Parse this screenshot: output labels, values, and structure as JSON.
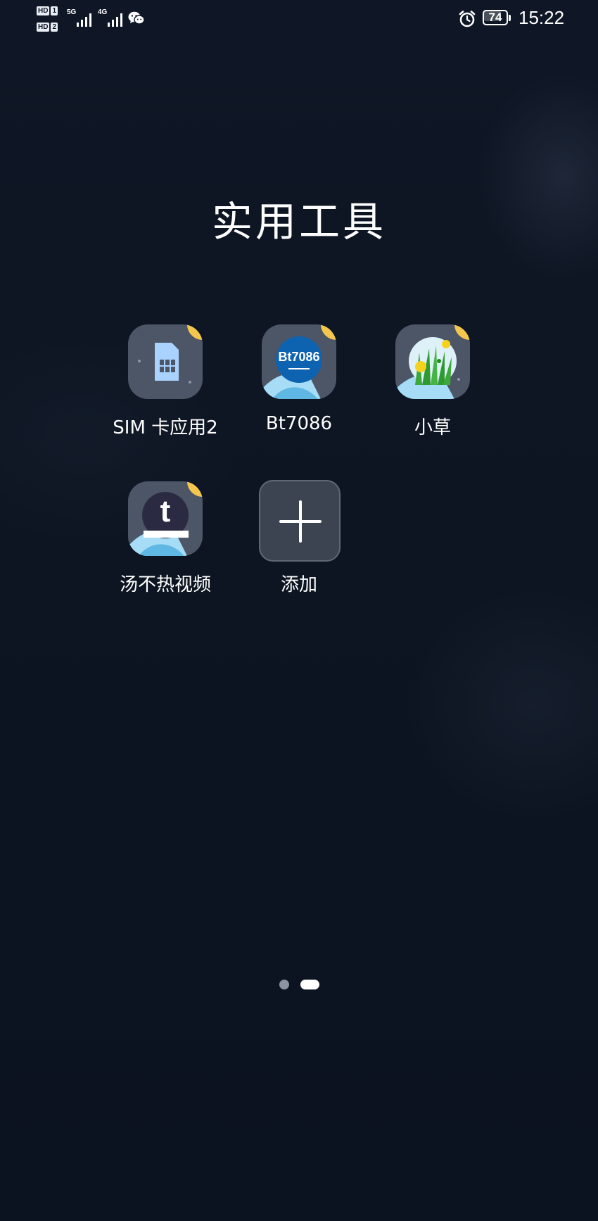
{
  "status_bar": {
    "sim1": {
      "hd": "HD",
      "slot": "1"
    },
    "sim2": {
      "hd": "HD",
      "slot": "2"
    },
    "signal1_tech": "5G",
    "signal2_tech": "4G",
    "notification_icon": "wechat-icon",
    "alarm_icon": "alarm-clock-icon",
    "battery_percent": "74",
    "battery_level": 0.74,
    "time": "15:22"
  },
  "folder": {
    "title": "实用工具"
  },
  "apps": [
    {
      "label": "SIM 卡应用2",
      "icon": "sim-card-icon",
      "badge_text": ""
    },
    {
      "label": "Bt7086",
      "icon": "bt7086-logo-icon",
      "badge_text": "Bt7086"
    },
    {
      "label": "小草",
      "icon": "grass-icon",
      "badge_text": ""
    },
    {
      "label": "汤不热视频",
      "icon": "tumblr-t-icon",
      "badge_text": "t"
    }
  ],
  "add_button": {
    "label": "添加",
    "icon": "plus-icon"
  },
  "pager": {
    "pages": 2,
    "current": 2
  },
  "colors": {
    "background": "#0d1522",
    "text": "#ffffff",
    "accent_corner": "#f4c64d",
    "icon_plate": "#4f5868"
  }
}
